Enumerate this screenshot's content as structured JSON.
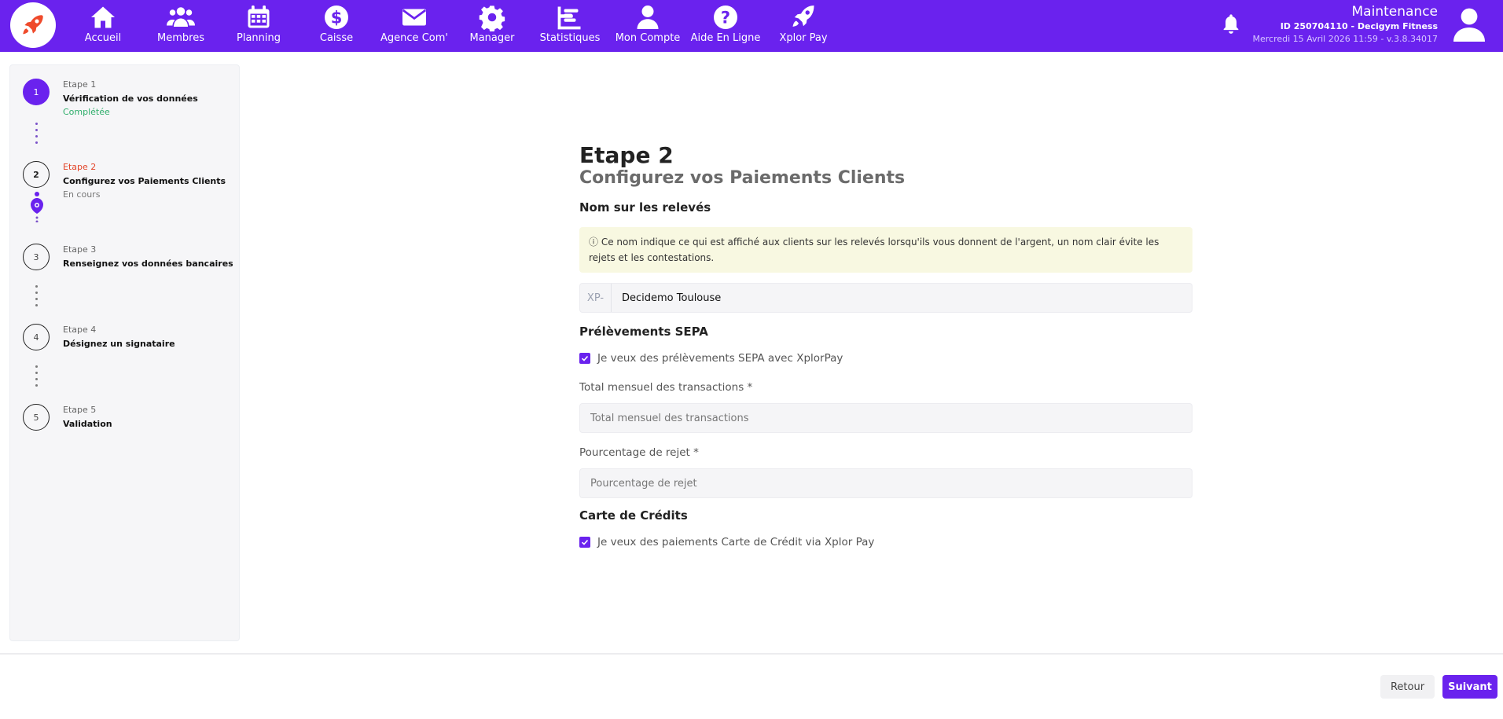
{
  "nav": {
    "items": [
      {
        "label": "Accueil",
        "icon": "home-icon"
      },
      {
        "label": "Membres",
        "icon": "users-icon"
      },
      {
        "label": "Planning",
        "icon": "calendar-icon"
      },
      {
        "label": "Caisse",
        "icon": "dollar-icon"
      },
      {
        "label": "Agence Com'",
        "icon": "envelope-icon"
      },
      {
        "label": "Manager",
        "icon": "gear-icon"
      },
      {
        "label": "Statistiques",
        "icon": "chart-icon"
      },
      {
        "label": "Mon Compte",
        "icon": "user-icon"
      },
      {
        "label": "Aide En Ligne",
        "icon": "help-icon"
      },
      {
        "label": "Xplor Pay",
        "icon": "rocket-icon"
      }
    ]
  },
  "user": {
    "name": "Maintenance",
    "id_line": "ID 250704110 - Decigym Fitness",
    "date_line": "Mercredi 15 Avril 2026 11:59 - v.3.8.34017"
  },
  "steps": [
    {
      "number": "1",
      "label": "Etape 1",
      "title": "Vérification de vos données",
      "status": "Complétée"
    },
    {
      "number": "2",
      "label": "Etape 2",
      "title": "Configurez vos Paiements Clients",
      "status": "En cours"
    },
    {
      "number": "3",
      "label": "Etape 3",
      "title": "Renseignez vos données bancaires"
    },
    {
      "number": "4",
      "label": "Etape 4",
      "title": "Désignez un signataire"
    },
    {
      "number": "5",
      "label": "Etape 5",
      "title": "Validation"
    }
  ],
  "form": {
    "heading": "Etape 2",
    "subheading": "Configurez vos Paiements Clients",
    "statement_section": "Nom sur les relevés",
    "notice": "Ce nom indique ce qui est affiché aux clients sur les relevés lorsqu'ils vous donnent de l'argent, un nom clair évite les rejets et les contestations.",
    "statement_prefix": "XP-",
    "statement_value": "Decidemo Toulouse",
    "sepa_section": "Prélèvements SEPA",
    "sepa_checkbox": "Je veux des prélèvements SEPA avec XplorPay",
    "monthly_label": "Total mensuel des transactions *",
    "monthly_placeholder": "Total mensuel des transactions",
    "reject_label": "Pourcentage de rejet *",
    "reject_placeholder": "Pourcentage de rejet",
    "card_section": "Carte de Crédits",
    "card_checkbox": "Je veux des paiements Carte de Crédit via Xplor Pay"
  },
  "footer": {
    "back": "Retour",
    "next": "Suivant"
  },
  "colors": {
    "brand": "#6a22ee",
    "active_step": "#e3452a",
    "completed": "#2fae6b",
    "logo_rocket": "#ef4a2b"
  }
}
